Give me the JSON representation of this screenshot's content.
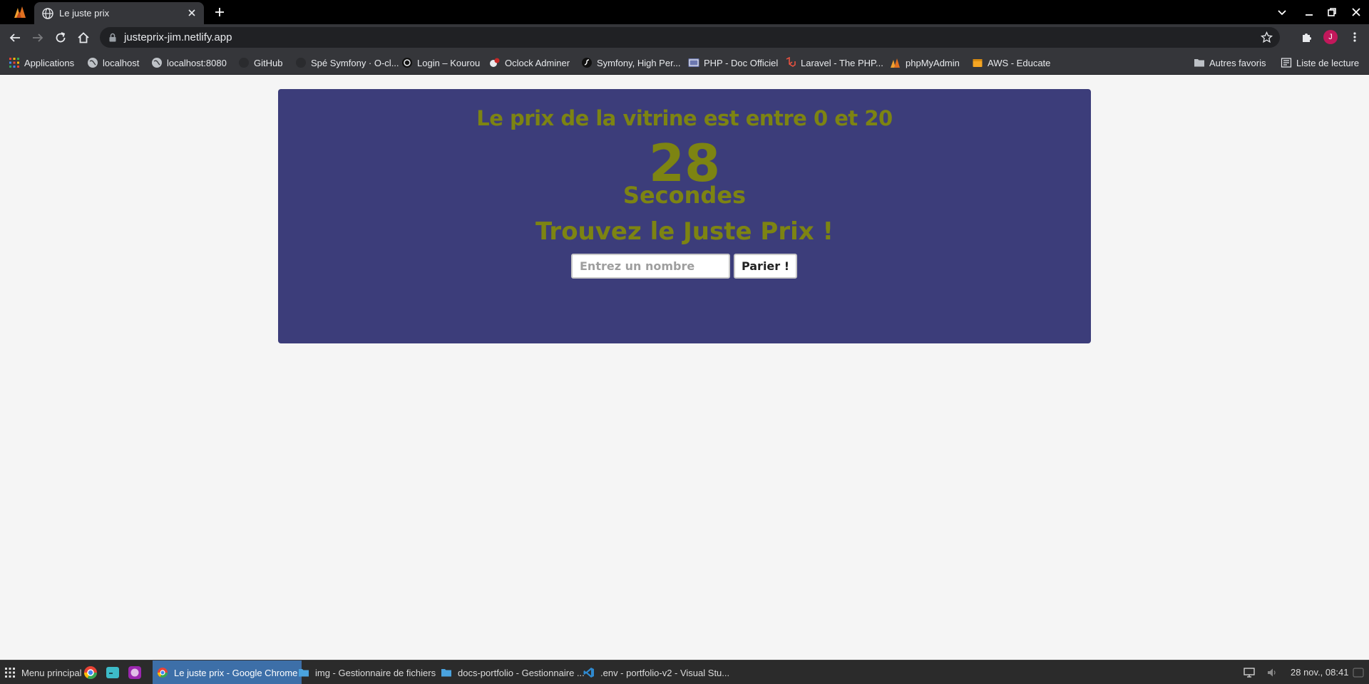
{
  "browser": {
    "tab_title": "Le juste prix",
    "url": "justeprix-jim.netlify.app",
    "profile_initial": "J"
  },
  "bookmarks": [
    {
      "label": "Applications",
      "icon": "apps-grid-icon"
    },
    {
      "label": "localhost",
      "icon": "globe-icon"
    },
    {
      "label": "localhost:8080",
      "icon": "globe-icon"
    },
    {
      "label": "GitHub",
      "icon": "github-icon"
    },
    {
      "label": "Spé Symfony · O-cl...",
      "icon": "github-icon"
    },
    {
      "label": "Login – Kourou",
      "icon": "kourou-icon"
    },
    {
      "label": "Oclock Adminer",
      "icon": "adminer-icon"
    },
    {
      "label": "Symfony, High Per...",
      "icon": "symfony-icon"
    },
    {
      "label": "PHP - Doc Officiel",
      "icon": "php-icon"
    },
    {
      "label": "Laravel - The PHP...",
      "icon": "laravel-icon"
    },
    {
      "label": "phpMyAdmin",
      "icon": "phpmyadmin-icon"
    },
    {
      "label": "AWS - Educate",
      "icon": "aws-icon"
    },
    {
      "label": "Autres favoris",
      "icon": "folder-icon"
    },
    {
      "label": "Liste de lecture",
      "icon": "reading-list-icon"
    }
  ],
  "game": {
    "range_text": "Le prix de la vitrine est entre 0 et 20",
    "timer_value": "28",
    "timer_unit": "Secondes",
    "headline": "Trouvez le Juste Prix !",
    "input_placeholder": "Entrez un nombre",
    "input_value": "",
    "button_label": "Parier !"
  },
  "colors": {
    "card_background": "#3c3d7a",
    "text_accent": "#7d8412",
    "page_background": "#f5f5f5"
  },
  "taskbar": {
    "menu_label": "Menu principal",
    "windows": [
      {
        "label": "Le juste prix - Google Chrome",
        "icon": "chrome-icon",
        "active": true
      },
      {
        "label": "img - Gestionnaire de fichiers",
        "icon": "folder-icon",
        "active": false
      },
      {
        "label": "docs-portfolio - Gestionnaire ...",
        "icon": "folder-icon",
        "active": false
      },
      {
        "label": ".env - portfolio-v2 - Visual Stu...",
        "icon": "vscode-icon",
        "active": false
      }
    ],
    "clock": "28 nov., 08:41"
  }
}
